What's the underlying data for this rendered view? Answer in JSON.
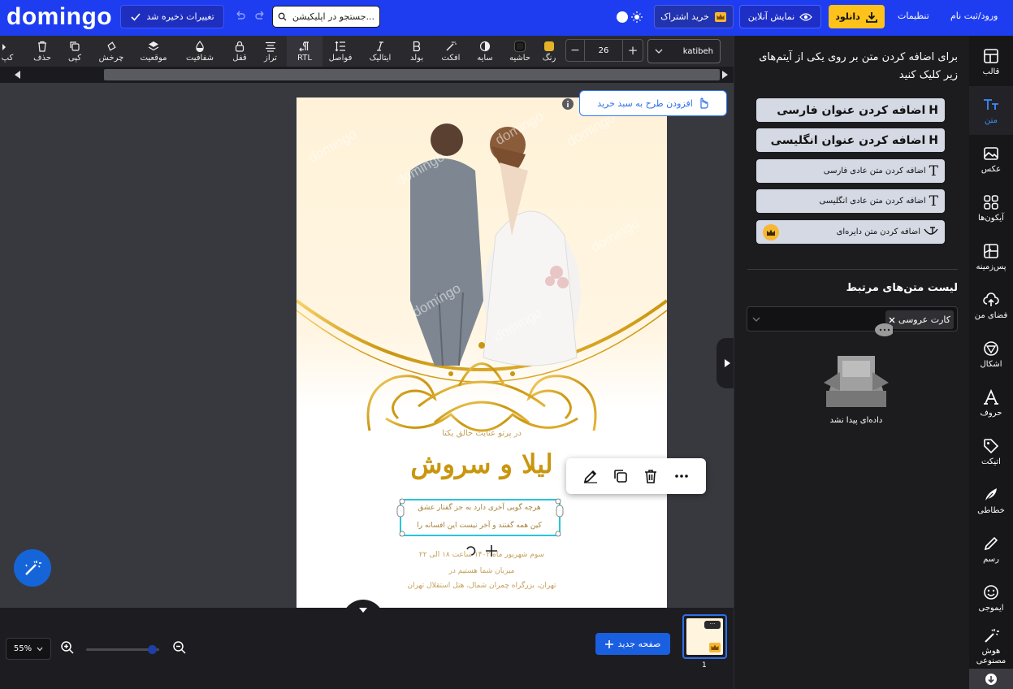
{
  "app": {
    "logo": "domingo"
  },
  "topbar": {
    "save_label": "تغییرات ذخیره شد",
    "search_placeholder": "جستجو در اپلیکیشن...",
    "subscribe_label": "خرید اشتراک",
    "online_label": "نمایش آنلاین",
    "download_label": "دانلود",
    "settings_label": "تنظیمات",
    "login_label": "ورود/ثبت نام"
  },
  "toolbar": {
    "tools": [
      "کپ",
      "حذف",
      "کپی",
      "چرخش",
      "موقعیت",
      "شفافیت",
      "قفل",
      "تراز",
      "RTL",
      "فواصل",
      "ایتالیک",
      "بولد",
      "افکت",
      "سایه",
      "حاشیه",
      "رنگ"
    ],
    "font_size": "26",
    "font_name": "katibeh"
  },
  "canvas": {
    "add_to_cart_label": "افزودن طرح به سبد خرید",
    "card": {
      "small_line": "در پرتو عنایت خالق یکتا",
      "names": "لیلا و سروش",
      "poem_line1": "هرچه گویی آخری دارد به جز گفتار عشق",
      "poem_line2": "کین همه گفتند و آخر نیست این افسانه را",
      "date_line": "سوم شهریور ماه ۱۴۰۲ ساعت ۱۸ الی ۲۲",
      "invite_line": "میزبان شما هستیم در",
      "address_line": "تهران، بزرگراه چمران شمال، هتل استقلال تهران",
      "watermark": "domingo"
    }
  },
  "bottom": {
    "zoom": "55%",
    "new_page_label": "صفحه جدید",
    "page_number": "1"
  },
  "right_panel": {
    "intro": "برای اضافه کردن متن بر روی یکی از آیتم‌های زیر کلیک کنید",
    "buttons": [
      {
        "label": "اضافه کردن عنوان فارسی",
        "icon": "H"
      },
      {
        "label": "اضافه کردن عنوان انگلیسی",
        "icon": "H"
      },
      {
        "label": "اضافه کردن متن عادی فارسی",
        "icon": "T"
      },
      {
        "label": "اضافه کردن متن عادی انگلیسی",
        "icon": "T"
      },
      {
        "label": "اضافه کردن متن دایره‌ای",
        "icon": "curve"
      }
    ],
    "related_title": "لیست متن‌های مرتبط",
    "tag": "کارت عروسی",
    "empty_label": "داده‌ای پیدا نشد"
  },
  "sidebar": {
    "items": [
      "قالب",
      "متن",
      "عکس",
      "آیکون‌ها",
      "پس‌زمینه",
      "فضای من",
      "اشکال",
      "حروف",
      "اتیکت",
      "خطاطی",
      "رسم",
      "ایموجی",
      "هوش مصنوعی"
    ]
  },
  "colors": {
    "brand": "#1e3df0",
    "accent": "#ffc21a",
    "selection": "#27c5de",
    "gold": "#c9960f"
  }
}
